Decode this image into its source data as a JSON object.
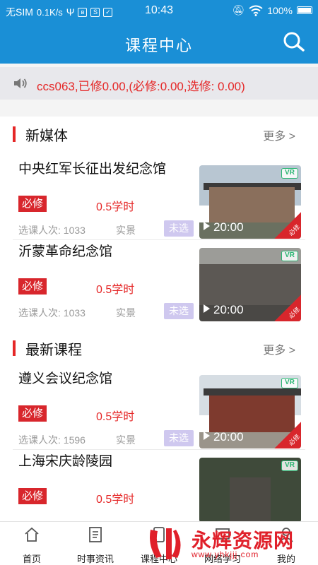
{
  "status_bar": {
    "carrier": "无SIM",
    "speed": "0.1K/s",
    "time": "10:43",
    "battery": "100%",
    "icons": [
      "usb-icon",
      "bluetooth-icon",
      "s-icon",
      "check-icon",
      "mute-icon",
      "wifi-icon",
      "battery-icon"
    ]
  },
  "header": {
    "title": "课程中心",
    "search_icon": "search-icon"
  },
  "notice": {
    "icon": "speaker-icon",
    "text": "ccs063,已修0.00,(必修:0.00,选修: 0.00)"
  },
  "sections": [
    {
      "title": "新媒体",
      "more": "更多 >",
      "courses": [
        {
          "title": "中央红军长征出发纪念馆",
          "badge": "必修",
          "hours": "0.5学时",
          "count": "选课人次: 1033",
          "type": "实景",
          "state": "未选",
          "duration": "20:00",
          "vr": "VR",
          "corner": "必修"
        },
        {
          "title": "沂蒙革命纪念馆",
          "badge": "必修",
          "hours": "0.5学时",
          "count": "选课人次: 1033",
          "type": "实景",
          "state": "未选",
          "duration": "20:00",
          "vr": "VR",
          "corner": "必修"
        }
      ]
    },
    {
      "title": "最新课程",
      "more": "更多 >",
      "courses": [
        {
          "title": "遵义会议纪念馆",
          "badge": "必修",
          "hours": "0.5学时",
          "count": "选课人次: 1596",
          "type": "实景",
          "state": "未选",
          "duration": "20:00",
          "vr": "VR",
          "corner": "必修"
        },
        {
          "title": "上海宋庆龄陵园",
          "badge": "必修",
          "hours": "0.5学时",
          "count": "",
          "type": "",
          "state": "",
          "duration": "",
          "vr": "VR",
          "corner": ""
        }
      ]
    }
  ],
  "tabs": [
    {
      "label": "首页",
      "icon": "home-icon"
    },
    {
      "label": "时事资讯",
      "icon": "news-icon"
    },
    {
      "label": "课程中心",
      "icon": "course-icon"
    },
    {
      "label": "网络学习",
      "icon": "learning-icon"
    },
    {
      "label": "我的",
      "icon": "profile-icon"
    }
  ],
  "watermark": {
    "text": "永辉资源网",
    "url": "www.yhkjjj.com"
  },
  "colors": {
    "brand": "#1a8fd6",
    "accent_red": "#e52727",
    "badge_red": "#d8262c",
    "unselected": "#cfc8ef",
    "vr_green": "#2bb673"
  }
}
